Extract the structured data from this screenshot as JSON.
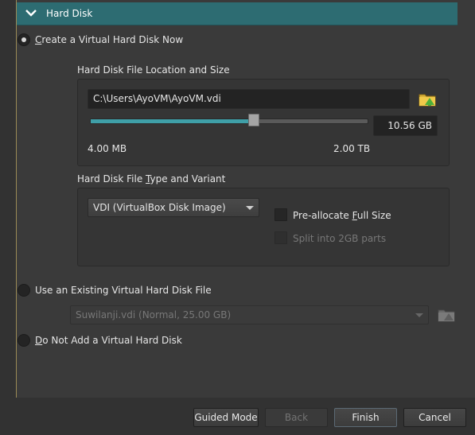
{
  "section": {
    "title": "Hard Disk"
  },
  "options": {
    "create_new": "Create a Virtual Hard Disk Now",
    "use_existing": "Use an Existing Virtual Hard Disk File",
    "none": "Do Not Add a Virtual Hard Disk"
  },
  "location": {
    "group_title": "Hard Disk File Location and Size",
    "path": "C:\\Users\\AyoVM\\AyoVM.vdi",
    "size_value": "10.56 GB",
    "min_label": "4.00 MB",
    "max_label": "2.00 TB",
    "slider_fraction": 0.59
  },
  "type": {
    "group_title_prefix": "Hard Disk File ",
    "group_title_accel": "T",
    "group_title_suffix": "ype and Variant",
    "format_selected": "VDI (VirtualBox Disk Image)",
    "preallocate_prefix": "Pre-allocate ",
    "preallocate_accel": "F",
    "preallocate_suffix": "ull Size",
    "split": "Split into 2GB parts"
  },
  "existing": {
    "selected": "Suwilanji.vdi (Normal, 25.00 GB)"
  },
  "buttons": {
    "guided": "Guided Mode",
    "back": "Back",
    "finish": "Finish",
    "cancel": "Cancel"
  },
  "colors": {
    "header": "#2d6c72",
    "accent": "#3f9fa8"
  }
}
